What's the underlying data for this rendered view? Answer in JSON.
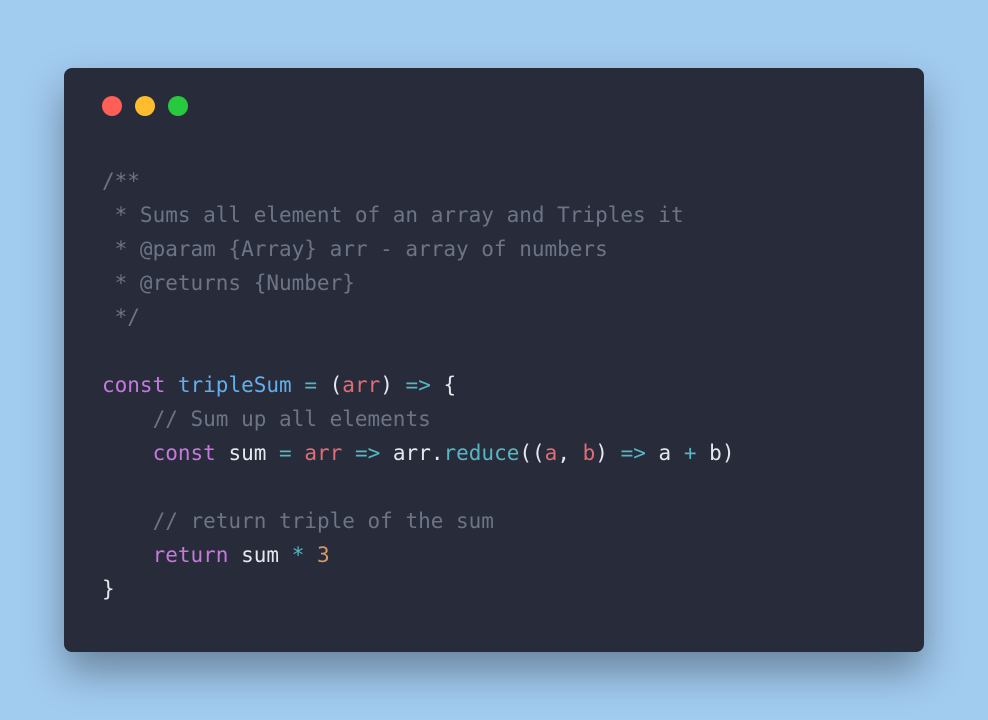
{
  "code": {
    "c1": "/**",
    "c2": " * Sums all element of an array and Triples it",
    "c3": " * @param {Array} arr - array of numbers",
    "c4": " * @returns {Number}",
    "c5": " */",
    "kw_const1": "const",
    "fn_name": "tripleSum",
    "eq1": "=",
    "paren_open1": "(",
    "param_arr1": "arr",
    "paren_close1": ")",
    "arrow1": "=>",
    "brace_open": "{",
    "c6": "// Sum up all elements",
    "kw_const2": "const",
    "var_sum1": "sum",
    "eq2": "=",
    "param_arr2": "arr",
    "arrow2": "=>",
    "var_arr3": "arr",
    "dot": ".",
    "method_reduce": "reduce",
    "paren_open2": "((",
    "param_a": "a",
    "comma": ", ",
    "param_b": "b",
    "paren_close2": ")",
    "arrow3": "=>",
    "var_a": "a",
    "plus": "+",
    "var_b": "b",
    "paren_close3": ")",
    "c7": "// return triple of the sum",
    "kw_return": "return",
    "var_sum2": "sum",
    "star": "*",
    "num_3": "3",
    "brace_close": "}"
  }
}
